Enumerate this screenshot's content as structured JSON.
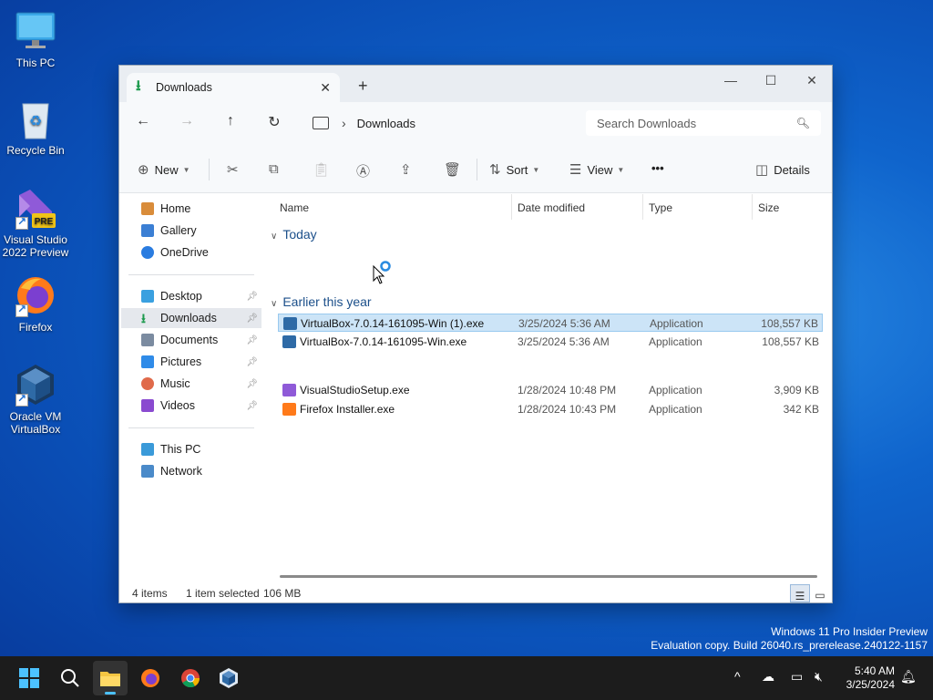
{
  "desktop": {
    "icons": [
      {
        "label": "This PC"
      },
      {
        "label": "Recycle Bin"
      },
      {
        "label": "Visual Studio 2022 Preview",
        "badge": "PRE"
      },
      {
        "label": "Firefox"
      },
      {
        "label": "Oracle VM VirtualBox"
      }
    ]
  },
  "explorer": {
    "tab_title": "Downloads",
    "new_tab": "+",
    "address": {
      "crumb": "Downloads"
    },
    "search_placeholder": "Search Downloads",
    "toolbar": {
      "new_label": "New",
      "sort_label": "Sort",
      "view_label": "View",
      "more_label": "•••",
      "details_label": "Details"
    },
    "sidebar": {
      "items": [
        {
          "label": "Home",
          "color": "#d98c3a"
        },
        {
          "label": "Gallery",
          "color": "#3b7fd4"
        },
        {
          "label": "OneDrive",
          "color": "#2a7ce0"
        },
        {
          "label": "Desktop",
          "color": "#3aa0e0"
        },
        {
          "label": "Downloads",
          "color": "#1c9a4d"
        },
        {
          "label": "Documents",
          "color": "#7b8ba0"
        },
        {
          "label": "Pictures",
          "color": "#2f8be8"
        },
        {
          "label": "Music",
          "color": "#e06a4a"
        },
        {
          "label": "Videos",
          "color": "#8a4ad0"
        },
        {
          "label": "This PC",
          "color": "#3a9ad9"
        },
        {
          "label": "Network",
          "color": "#4a8ac9"
        }
      ]
    },
    "columns": {
      "name": "Name",
      "date": "Date modified",
      "type": "Type",
      "size": "Size"
    },
    "groups": [
      {
        "label": "Today",
        "files": [
          {
            "name": "VirtualBox-7.0.14-161095-Win (1).exe",
            "date": "3/25/2024 5:36 AM",
            "type": "Application",
            "size": "108,557 KB"
          },
          {
            "name": "VirtualBox-7.0.14-161095-Win.exe",
            "date": "3/25/2024 5:36 AM",
            "type": "Application",
            "size": "108,557 KB"
          }
        ]
      },
      {
        "label": "Earlier this year",
        "files": [
          {
            "name": "VisualStudioSetup.exe",
            "date": "1/28/2024 10:48 PM",
            "type": "Application",
            "size": "3,909 KB"
          },
          {
            "name": "Firefox Installer.exe",
            "date": "1/28/2024 10:43 PM",
            "type": "Application",
            "size": "342 KB"
          }
        ]
      }
    ],
    "status": {
      "count": "4 items",
      "selected": "1 item selected",
      "size": "106 MB"
    }
  },
  "watermark": {
    "line1": "Windows 11 Pro Insider Preview",
    "line2": "Evaluation copy. Build 26040.rs_prerelease.240122-1157"
  },
  "clock": {
    "time": "5:40 AM",
    "date": "3/25/2024"
  }
}
